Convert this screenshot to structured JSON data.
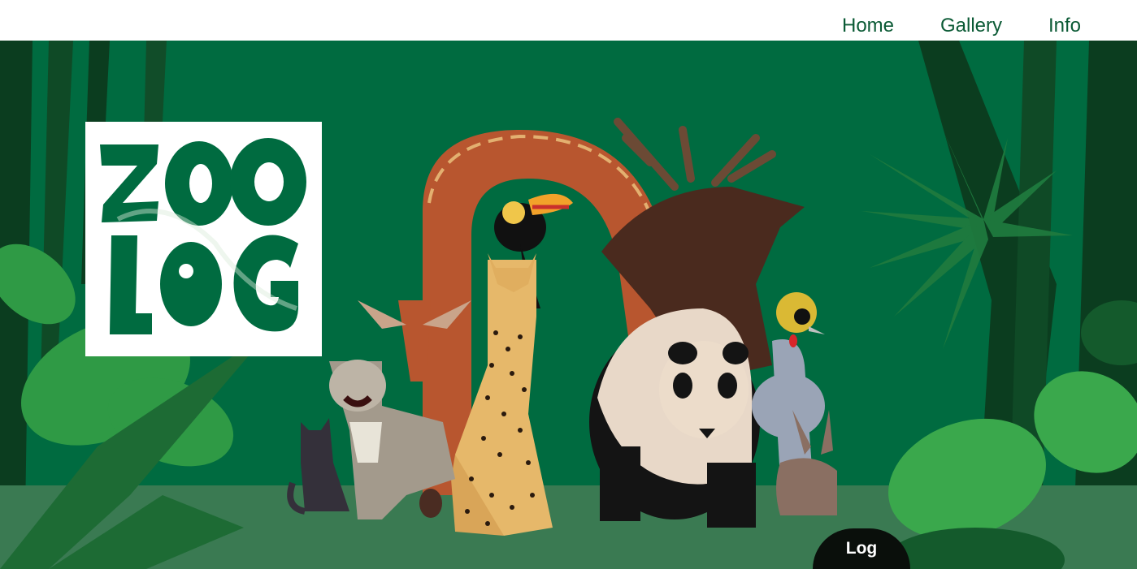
{
  "nav": {
    "home_label": "Home",
    "gallery_label": "Gallery",
    "info_label": "Info"
  },
  "logo": {
    "text": "ZOO LOG"
  },
  "hero": {
    "log_button_label": "Log"
  },
  "colors": {
    "brand_green": "#006b40",
    "dark_green": "#0b3d1f",
    "nav_text": "#0b5a35",
    "ground": "#3a7a52",
    "button_bg": "#0a0f0b"
  }
}
